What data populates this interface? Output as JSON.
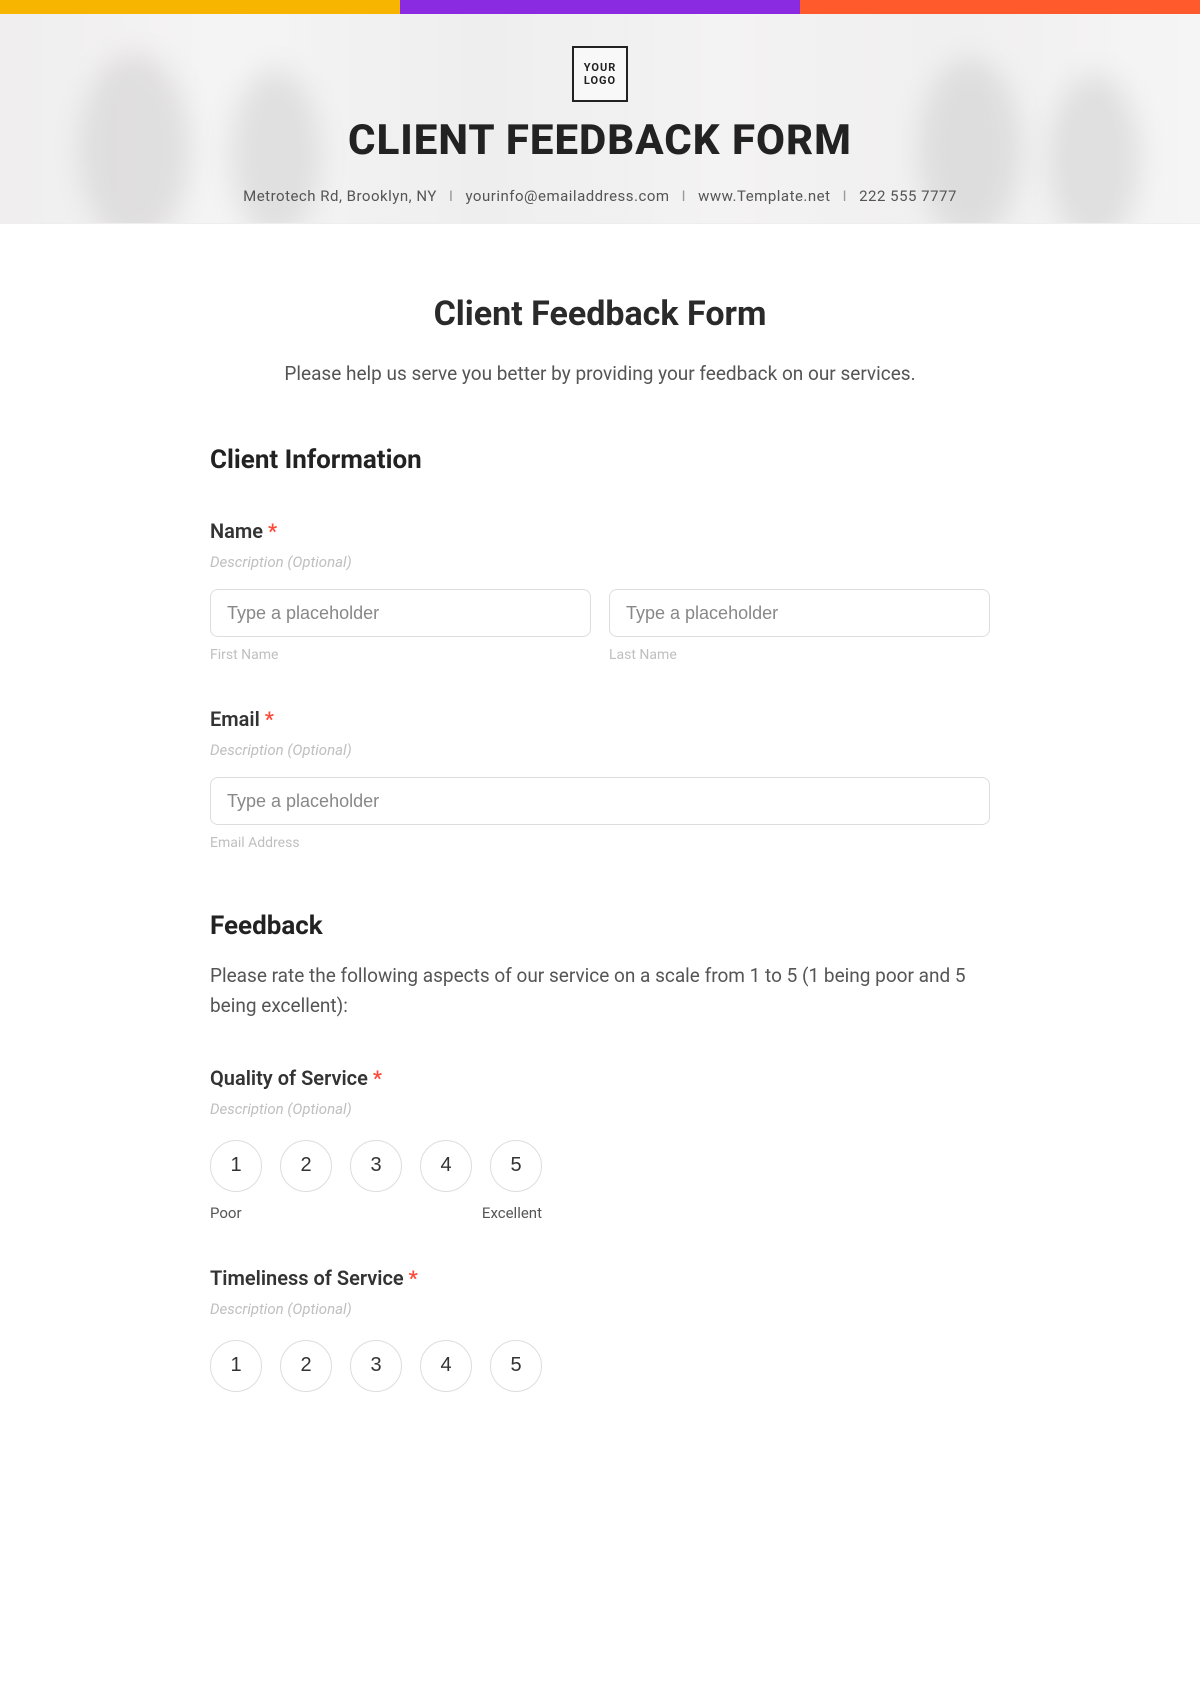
{
  "colors": {
    "stripe1": "#f7b500",
    "stripe2": "#8a2be2",
    "stripe3": "#ff5a2c",
    "required": "#ff4a3a"
  },
  "hero": {
    "logo_text": "YOUR\nLOGO",
    "title": "CLIENT FEEDBACK FORM",
    "address": "Metrotech Rd, Brooklyn, NY",
    "email": "yourinfo@emailaddress.com",
    "website": "www.Template.net",
    "phone": "222 555 7777",
    "separator": "I"
  },
  "form": {
    "title": "Client Feedback Form",
    "intro": "Please help us serve you better by providing your feedback on our services.",
    "desc_placeholder": "Description (Optional)",
    "input_placeholder": "Type a placeholder",
    "required_mark": "*",
    "sections": {
      "client_info": {
        "heading": "Client Information",
        "name": {
          "label": "Name",
          "first_sub": "First Name",
          "last_sub": "Last Name"
        },
        "email": {
          "label": "Email",
          "sub": "Email Address"
        }
      },
      "feedback": {
        "heading": "Feedback",
        "intro": "Please rate the following aspects of our service on a scale from 1 to 5 (1 being poor and 5 being excellent):",
        "ratings": [
          "1",
          "2",
          "3",
          "4",
          "5"
        ],
        "caption_low": "Poor",
        "caption_high": "Excellent",
        "quality": {
          "label": "Quality of Service"
        },
        "timeliness": {
          "label": "Timeliness of Service"
        }
      }
    }
  }
}
